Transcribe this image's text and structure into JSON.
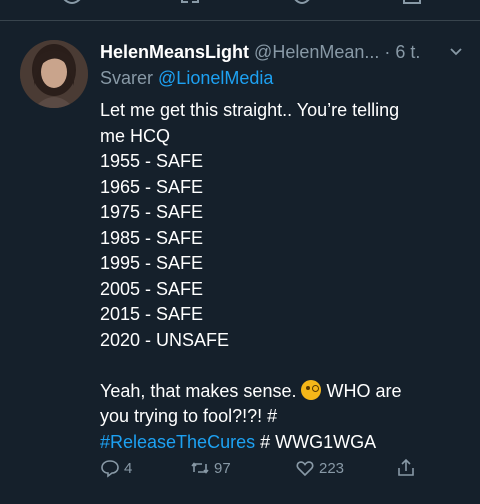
{
  "tweet": {
    "display_name": "HelenMeansLight",
    "handle": "@HelenMean...",
    "separator": "·",
    "time": "6 t.",
    "reply_prefix": "Svarer",
    "reply_handle": "@LionelMedia",
    "body_lines": [
      "Let me get this straight.. You’re telling",
      "me HCQ",
      "1955 - SAFE",
      "1965 - SAFE",
      "1975 - SAFE",
      "1985 - SAFE",
      "1995 - SAFE",
      "2005 - SAFE",
      "2015 - SAFE",
      "2020 - UNSAFE"
    ],
    "closing_line_1": "Yeah, that makes sense.",
    "closing_line_1_after": "WHO are",
    "closing_line_2": "you trying to fool?!?! #",
    "hashtag_1": "#ReleaseTheCures",
    "hashtag_2": "# WWG1WGA",
    "emoji_icon": "face-with-monocle-emoji",
    "reply_count": "4",
    "retweet_count": "97",
    "like_count": "223"
  },
  "colors": {
    "background": "#15202b",
    "secondary_text": "#8899a6",
    "link": "#1da1f2",
    "divider": "#38444d"
  }
}
